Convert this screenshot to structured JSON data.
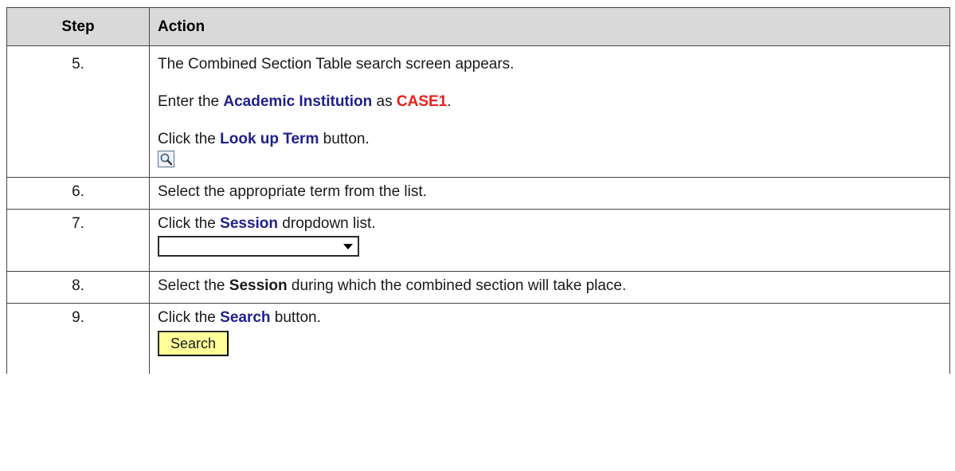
{
  "table": {
    "headers": {
      "step": "Step",
      "action": "Action"
    },
    "rows": [
      {
        "step": "5.",
        "p1": "The Combined Section Table search screen appears.",
        "p2": {
          "pre": "Enter the ",
          "field": "Academic Institution",
          "mid": " as ",
          "value": "CASE1",
          "post": "."
        },
        "p3": {
          "pre": "Click the ",
          "target": "Look up Term",
          "post": " button."
        },
        "icon": "magnifying-glass-lookup-icon"
      },
      {
        "step": "6.",
        "p1": "Select the appropriate term from the list."
      },
      {
        "step": "7.",
        "p1": {
          "pre": "Click the ",
          "target": "Session",
          "post": " dropdown list."
        },
        "dropdown_value": ""
      },
      {
        "step": "8.",
        "p1": {
          "pre": "Select the ",
          "target": "Session",
          "post": " during which the combined section will take place."
        }
      },
      {
        "step": "9.",
        "p1": {
          "pre": "Click the ",
          "target": "Search",
          "post": " button."
        },
        "button_label": "Search"
      }
    ]
  },
  "colors": {
    "header_bg": "#d9d9d9",
    "field_blue": "#1f1f8c",
    "value_red": "#e8201a",
    "search_button_bg": "#ffff99"
  }
}
